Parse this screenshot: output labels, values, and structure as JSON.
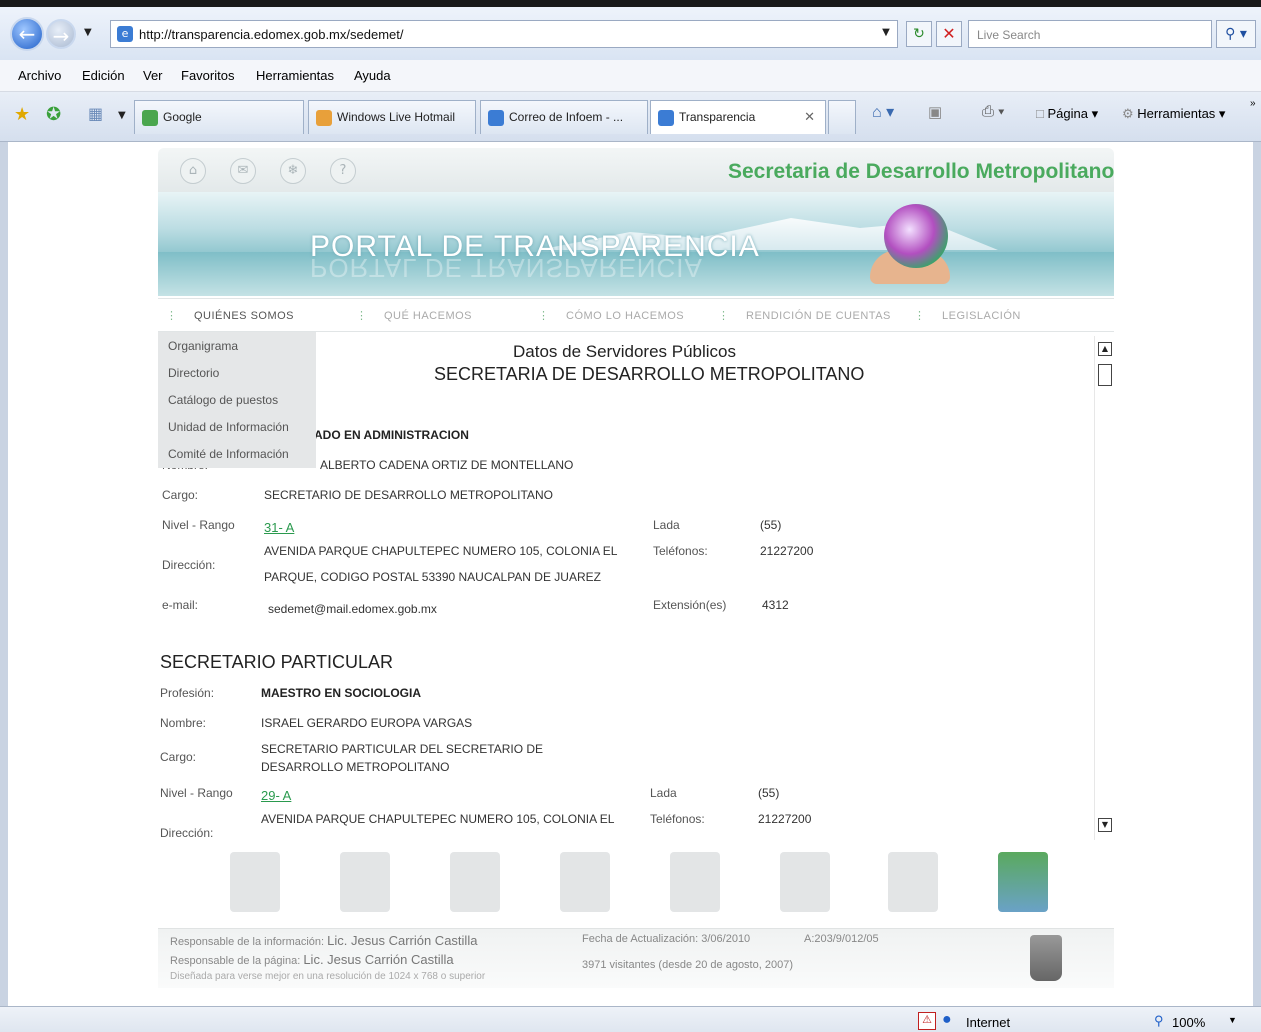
{
  "browser": {
    "url": "http://transparencia.edomex.gob.mx/sedemet/",
    "search_placeholder": "Live Search",
    "menu": [
      "Archivo",
      "Edición",
      "Ver",
      "Favoritos",
      "Herramientas",
      "Ayuda"
    ],
    "tabs": [
      {
        "label": "Google",
        "color": "#4aa64e"
      },
      {
        "label": "Windows Live Hotmail",
        "color": "#e8a03a"
      },
      {
        "label": "Correo de Infoem - ...",
        "color": "#3b7cd4"
      },
      {
        "label": "Transparencia",
        "color": "#3b7cd4"
      }
    ],
    "commands": [
      "Página",
      "Herramientas"
    ],
    "status": {
      "zone": "Internet",
      "zoom": "100%"
    }
  },
  "site": {
    "secretaria": "Secretaria de Desarrollo Metropolitano",
    "portal_title": "PORTAL DE TRANSPARENCIA",
    "nav": [
      "QUIÉNES SOMOS",
      "QUÉ HACEMOS",
      "CÓMO LO HACEMOS",
      "RENDICIÓN DE CUENTAS",
      "LEGISLACIÓN"
    ],
    "dropdown": [
      "Organigrama",
      "Directorio",
      "Catálogo de puestos",
      "Unidad de Información",
      "Comité de Información"
    ]
  },
  "content": {
    "title": "Datos de Servidores Públicos",
    "subtitle": "SECRETARIA DE DESARROLLO METROPOLITANO",
    "person1": {
      "profesion_partial": "ADO EN ADMINISTRACION",
      "nombre_label": "Nombre:",
      "nombre_partial": "ALBERTO CADENA ORTIZ DE MONTELLANO",
      "cargo_label": "Cargo:",
      "cargo": "SECRETARIO DE DESARROLLO METROPOLITANO",
      "nivel_label": "Nivel - Rango",
      "nivel": "31- A",
      "lada_label": "Lada",
      "lada": "(55)",
      "direccion_label": "Dirección:",
      "direccion_1": "AVENIDA PARQUE CHAPULTEPEC NUMERO 105, COLONIA EL",
      "direccion_2": "PARQUE, CODIGO POSTAL 53390  NAUCALPAN DE JUAREZ",
      "telefonos_label": "Teléfonos:",
      "telefonos": "21227200",
      "email_label": "e-mail:",
      "email": "sedemet@mail.edomex.gob.mx",
      "extension_label": "Extensión(es)",
      "extension": "4312"
    },
    "section2": "SECRETARIO PARTICULAR",
    "person2": {
      "profesion_label": "Profesión:",
      "profesion": "MAESTRO EN SOCIOLOGIA",
      "nombre_label": "Nombre:",
      "nombre": "ISRAEL GERARDO EUROPA VARGAS",
      "cargo_label": "Cargo:",
      "cargo_1": "SECRETARIO PARTICULAR DEL SECRETARIO DE",
      "cargo_2": "DESARROLLO METROPOLITANO",
      "nivel_label": "Nivel - Rango",
      "nivel": "29- A",
      "lada_label": "Lada",
      "lada": "(55)",
      "direccion_label": "Dirección:",
      "direccion_1": "AVENIDA PARQUE CHAPULTEPEC NUMERO 105, COLONIA EL",
      "telefonos_label": "Teléfonos:",
      "telefonos": "21227200"
    }
  },
  "footer": {
    "resp_info_label": "Responsable de la información:",
    "resp_info": "Lic. Jesus Carrión Castilla",
    "resp_page_label": "Responsable de la página:",
    "resp_page": "Lic. Jesus Carrión Castilla",
    "design_note": "Diseñada para verse mejor en una resolución de 1024 x 768 o superior",
    "fecha": "Fecha de Actualización: 3/06/2010",
    "code": "A:203/9/012/05",
    "visits": "3971 visitantes (desde 20 de agosto, 2007)"
  }
}
